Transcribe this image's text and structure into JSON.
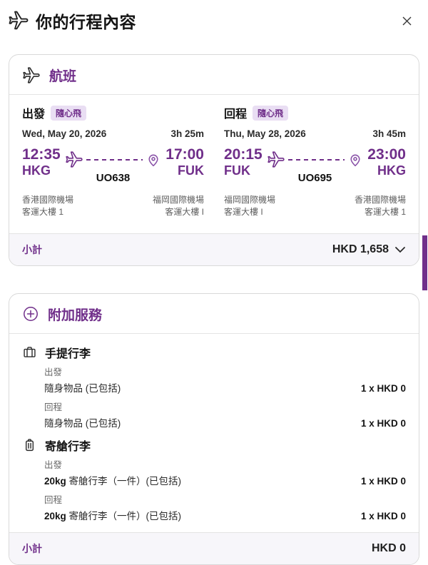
{
  "header": {
    "title": "你的行程內容"
  },
  "colors": {
    "brand_purple": "#702f8a",
    "badge_bg": "#e9def3",
    "subtotal_bg": "#f7f6fa",
    "card_border": "#d9d9d9",
    "text_dark": "#1f1f1f",
    "text_gray": "#5f5f5f"
  },
  "icons": {
    "header": "plane-icon",
    "flights_section": "plane-icon",
    "route_start": "plane-icon",
    "route_end": "location-pin-icon",
    "addons_section": "plus-circle-icon",
    "hand_baggage": "briefcase-icon",
    "checked_baggage": "suitcase-icon",
    "subtotal_toggle": "chevron-down-icon",
    "close": "close-icon"
  },
  "flight_card": {
    "title": "航班",
    "segments": [
      {
        "direction": "出發",
        "badge": "隨心飛",
        "date": "Wed, May 20, 2026",
        "duration": "3h 25m",
        "dep_time": "12:35",
        "dep_code": "HKG",
        "arr_time": "17:00",
        "arr_code": "FUK",
        "flight_no": "UO638",
        "dep_airport": "香港國際機場",
        "dep_terminal": "客運大樓 1",
        "arr_airport": "福岡國際機場",
        "arr_terminal": "客運大樓 I"
      },
      {
        "direction": "回程",
        "badge": "隨心飛",
        "date": "Thu, May 28, 2026",
        "duration": "3h 45m",
        "dep_time": "20:15",
        "dep_code": "FUK",
        "arr_time": "23:00",
        "arr_code": "HKG",
        "flight_no": "UO695",
        "dep_airport": "福岡國際機場",
        "dep_terminal": "客運大樓 I",
        "arr_airport": "香港國際機場",
        "arr_terminal": "客運大樓 1"
      }
    ],
    "subtotal_label": "小計",
    "subtotal_value": "HKD 1,658"
  },
  "addons_card": {
    "title": "附加服務",
    "groups": [
      {
        "title": "手提行李",
        "sections": [
          {
            "label": "出發",
            "item_bold": "",
            "item_text": "隨身物品 (已包括)",
            "price": "1 x HKD 0"
          },
          {
            "label": "回程",
            "item_bold": "",
            "item_text": "隨身物品 (已包括)",
            "price": "1 x HKD 0"
          }
        ]
      },
      {
        "title": "寄艙行李",
        "sections": [
          {
            "label": "出發",
            "item_bold": "20kg",
            "item_text": " 寄艙行李（一件）(已包括)",
            "price": "1 x HKD 0"
          },
          {
            "label": "回程",
            "item_bold": "20kg",
            "item_text": " 寄艙行李（一件）(已包括)",
            "price": "1 x HKD 0"
          }
        ]
      }
    ],
    "subtotal_label": "小計",
    "subtotal_value": "HKD 0"
  }
}
